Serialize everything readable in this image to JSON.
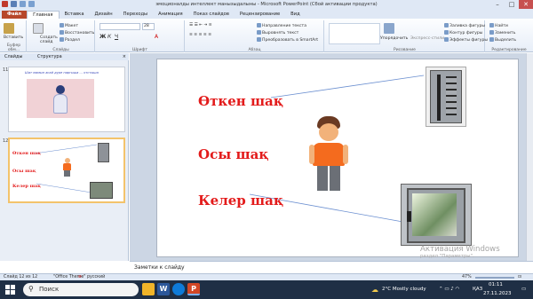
{
  "window": {
    "title": "эмоционалды интеллект манызыдалыны  -  Microsoft PowerPoint (Сбой активации продукта)",
    "controls": {
      "minimize": "–",
      "maximize": "□",
      "close": "✕"
    }
  },
  "tabs": [
    "Файл",
    "Главная",
    "Вставка",
    "Дизайн",
    "Переходы",
    "Анимация",
    "Показ слайдов",
    "Рецензирование",
    "Вид"
  ],
  "active_tab": "Главная",
  "ribbon": {
    "clipboard": {
      "paste": "Вставить",
      "label": "Буфер обм..."
    },
    "slides": {
      "new_slide": "Создать слайд",
      "layout": "Макет",
      "reset": "Восстановить",
      "section": "Раздел",
      "label": "Слайды"
    },
    "font": {
      "label": "Шрифт",
      "size": "28"
    },
    "paragraph": {
      "text_direction": "Направление текста",
      "align_text": "Выровнять текст",
      "smartart": "Преобразовать в SmartArt",
      "label": "Абзац"
    },
    "drawing": {
      "arrange": "Упорядочить",
      "quick_styles": "Экспресс-стили",
      "fill": "Заливка фигуры",
      "outline": "Контур фигуры",
      "effects": "Эффекты фигуры",
      "label": "Рисование"
    },
    "editing": {
      "find": "Найти",
      "replace": "Заменить",
      "select": "Выделить",
      "label": "Редактирование"
    }
  },
  "pane": {
    "tab_slides": "Слайды",
    "tab_outline": "Структура",
    "close": "×"
  },
  "thumbnails": [
    {
      "number": "11",
      "caption": "Шат мамып асай дүре наргыша ... отстыша"
    },
    {
      "number": "12",
      "lines": [
        "Өткен шақ",
        "Осы шақ",
        "Келер шақ"
      ]
    }
  ],
  "slide": {
    "past": "Өткен шақ",
    "present": "Осы шақ",
    "future": "Келер шақ"
  },
  "watermark": {
    "line1": "Активация Windows",
    "line2": "раздел \"Параметры\"."
  },
  "notes": {
    "placeholder": "Заметки к слайду"
  },
  "status": {
    "slide_count": "Слайд 12 из 12",
    "theme": "\"Office Theme\"",
    "language": "русский",
    "zoom": "47%"
  },
  "taskbar": {
    "search": "Поиск",
    "weather": "2°C  Mostly cloudy",
    "lang": "ҚАЗ",
    "time": "01:11",
    "date": "27.11.2023"
  },
  "colors": {
    "accent": "#b7472a",
    "slide_text": "#e31b1b",
    "taskbar": "#1f2f45"
  }
}
